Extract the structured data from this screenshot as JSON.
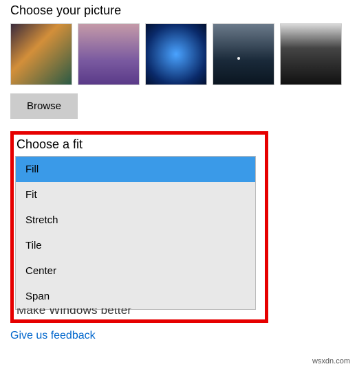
{
  "picture_section": {
    "title": "Choose your picture",
    "browse_label": "Browse",
    "thumbs": [
      {
        "name": "wallpaper-thumb-1"
      },
      {
        "name": "wallpaper-thumb-2"
      },
      {
        "name": "wallpaper-thumb-3"
      },
      {
        "name": "wallpaper-thumb-4"
      },
      {
        "name": "wallpaper-thumb-5"
      }
    ]
  },
  "fit_section": {
    "title": "Choose a fit",
    "options": [
      {
        "label": "Fill",
        "selected": true
      },
      {
        "label": "Fit",
        "selected": false
      },
      {
        "label": "Stretch",
        "selected": false
      },
      {
        "label": "Tile",
        "selected": false
      },
      {
        "label": "Center",
        "selected": false
      },
      {
        "label": "Span",
        "selected": false
      }
    ]
  },
  "truncated_text": "Make Windows better",
  "feedback_link": "Give us feedback",
  "watermark": "wsxdn.com"
}
